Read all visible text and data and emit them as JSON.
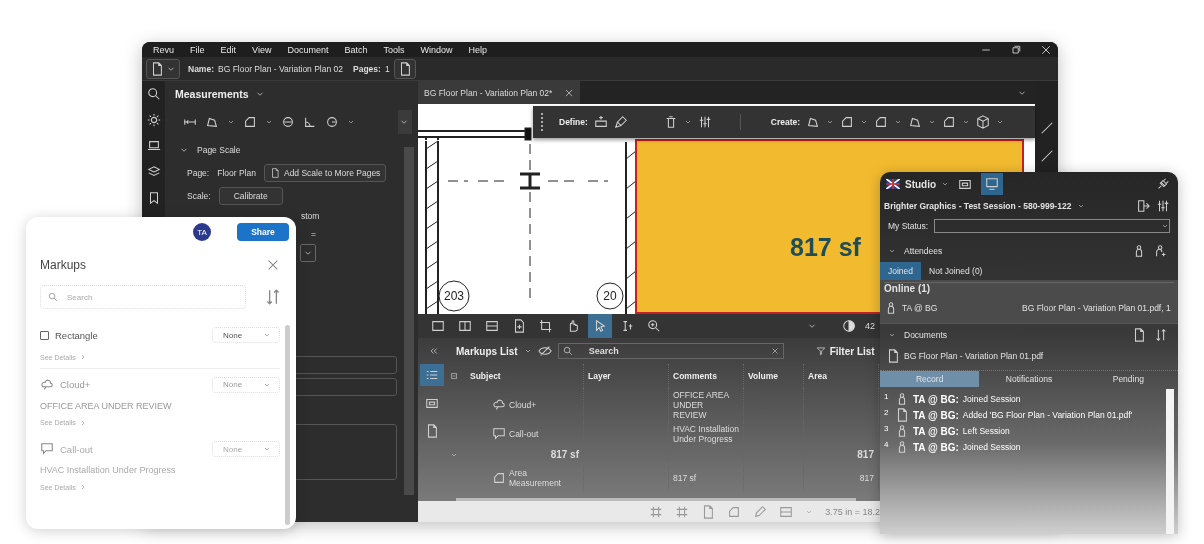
{
  "menu": [
    "Revu",
    "File",
    "Edit",
    "View",
    "Document",
    "Batch",
    "Tools",
    "Window",
    "Help"
  ],
  "file_bar": {
    "name_label": "Name:",
    "name": "BG Floor Plan - Variation Plan 02",
    "pages_label": "Pages:",
    "pages": "1"
  },
  "measurements": {
    "title": "Measurements",
    "section": "Page Scale",
    "section_expanded": true,
    "page_label": "Page:",
    "page": "Floor Plan",
    "add_scale_button": "Add Scale to More Pages",
    "scale_label": "Scale:",
    "calibrate_button": "Calibrate",
    "partial_label": "stom",
    "partial_symbol": "="
  },
  "document_tab": {
    "title": "BG Floor Plan - Variation Plan 02*"
  },
  "floating_toolbar": {
    "define_label": "Define:",
    "create_label": "Create:"
  },
  "canvas": {
    "area_label": "817 sf",
    "room_numbers": [
      "203",
      "20"
    ]
  },
  "view_toolbar": {
    "zoom_partial": "42",
    "tools": [
      {
        "kind": "single",
        "selected": false
      },
      {
        "kind": "split-v",
        "selected": false
      },
      {
        "kind": "split-h",
        "selected": false
      },
      {
        "kind": "insert",
        "selected": false
      },
      {
        "kind": "crop",
        "selected": false
      },
      {
        "kind": "hand",
        "selected": false
      },
      {
        "kind": "pointer",
        "selected": true
      },
      {
        "kind": "text",
        "selected": false
      },
      {
        "kind": "zoom",
        "selected": false
      }
    ]
  },
  "markups_list": {
    "title": "Markups List",
    "search_placeholder": "Search",
    "filter": "Filter List",
    "side_tabs": [
      {
        "selected": true
      },
      {
        "selected": false
      },
      {
        "selected": false
      }
    ],
    "columns": [
      "Subject",
      "Layer",
      "Comments",
      "Volume",
      "Area"
    ],
    "rows": [
      {
        "kind": "cloud",
        "subject": "Cloud+",
        "comments": "OFFICE AREA UNDER REVIEW"
      },
      {
        "kind": "callout",
        "subject": "Call-out",
        "comments": "HVAC Installation Under Progress"
      },
      {
        "kind": "group",
        "subject": "817 sf",
        "area": "817"
      },
      {
        "kind": "area",
        "subject": "Area Measurement",
        "comments": "817 sf",
        "area": "817"
      }
    ]
  },
  "status_bar": {
    "scale": "3.75 in = 18.2"
  },
  "markups_panel": {
    "avatar": "TA",
    "share_button": "Share",
    "title": "Markups",
    "search_placeholder": "Search",
    "items": [
      {
        "kind": "checkbox",
        "checked": false,
        "title": "Rectangle",
        "status": "None",
        "details": "See Details"
      },
      {
        "kind": "cloud",
        "title": "Cloud+",
        "status": "None",
        "comment": "OFFICE AREA UNDER REVIEW",
        "details": "See Details"
      },
      {
        "kind": "callout",
        "title": "Call-out",
        "status": "None",
        "comment": "HVAC Installation Under Progress",
        "details": "See Details"
      }
    ]
  },
  "studio": {
    "title": "Studio",
    "mode_tabs": [
      {
        "selected": false
      },
      {
        "selected": true
      }
    ],
    "session": "Brighter Graphics - Test Session - 580-999-122",
    "status_label": "My Status:",
    "attendees": {
      "title": "Attendees",
      "expanded": true,
      "tabs": [
        {
          "label": "Joined",
          "selected": true
        },
        {
          "label": "Not Joined (0)",
          "selected": false
        }
      ],
      "group": "Online (1)",
      "people": [
        {
          "name": "TA @ BG",
          "document": "BG Floor Plan - Variation Plan 01.pdf, 1"
        }
      ]
    },
    "documents": {
      "title": "Documents",
      "expanded": true,
      "files": [
        "BG Floor Plan - Variation Plan 01.pdf"
      ]
    },
    "record_tabs": [
      {
        "label": "Record",
        "selected": true
      },
      {
        "label": "Notifications",
        "selected": false
      },
      {
        "label": "Pending",
        "selected": false
      }
    ],
    "records": [
      {
        "number": "1",
        "kind": "person",
        "user": "TA @ BG:",
        "action": "Joined Session"
      },
      {
        "number": "2",
        "kind": "document",
        "user": "TA @ BG:",
        "action": "Added 'BG Floor Plan - Variation Plan 01.pdf'"
      },
      {
        "number": "3",
        "kind": "person",
        "user": "TA @ BG:",
        "action": "Left Session"
      },
      {
        "number": "4",
        "kind": "person",
        "user": "TA @ BG:",
        "action": "Joined Session"
      }
    ]
  }
}
